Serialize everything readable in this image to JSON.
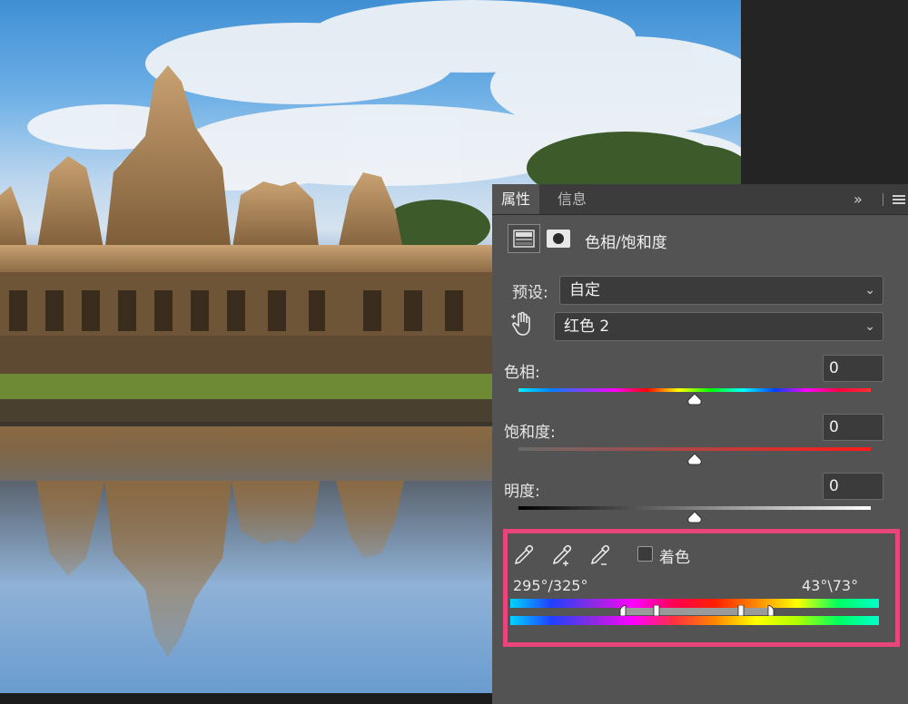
{
  "panel": {
    "tabs": [
      "属性",
      "信息"
    ],
    "collapse_glyph": "»",
    "adjustment_title": "色相/饱和度",
    "preset_label": "预设:",
    "preset_value": "自定",
    "range_value": "红色 2",
    "chevron": "⌄",
    "hue_label": "色相:",
    "hue_value": "0",
    "hue_level": 0,
    "saturation_label": "饱和度:",
    "saturation_value": "0",
    "saturation_level": 0,
    "lightness_label": "明度:",
    "lightness_value": "0",
    "lightness_level": 0,
    "colorize_label": "着色",
    "colorize_checked": false,
    "range_left_text": "295°/325°",
    "range_right_text": "43°\\73°"
  },
  "icons": [
    "hue-saturation-adjustment-icon",
    "layer-mask-icon",
    "targeted-adjustment-hand-icon",
    "eyedropper-icon",
    "eyedropper-add-icon",
    "eyedropper-subtract-icon",
    "panel-menu-icon"
  ],
  "colors": {
    "panel_bg": "#535353",
    "tab_bg": "#3c3c3c",
    "highlight": "#e8457a"
  }
}
